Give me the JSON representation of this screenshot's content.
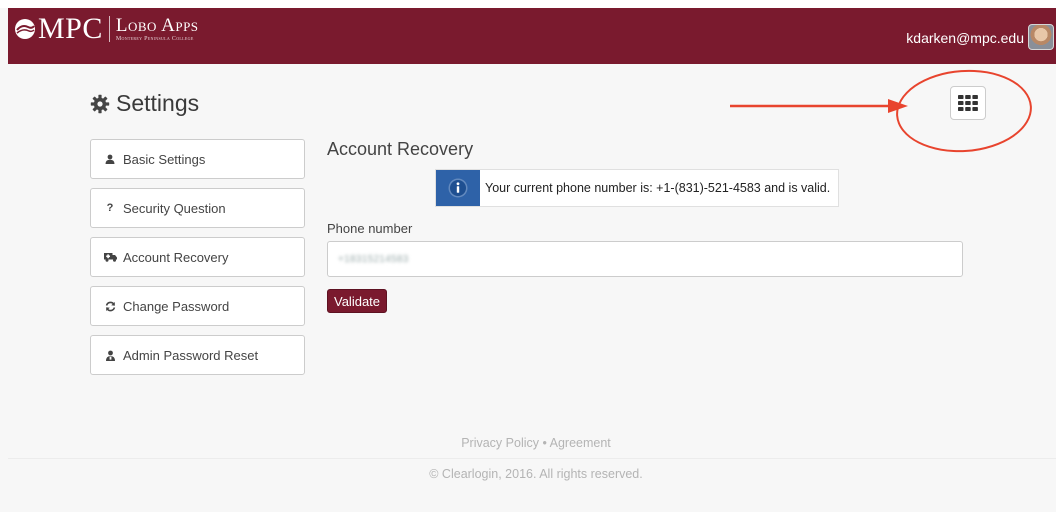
{
  "header": {
    "logo_main": "MPC",
    "logo_apps": "Lobo Apps",
    "logo_sub": "Monterey Peninsula College",
    "user_email": "kdarken@mpc.edu",
    "brand_color": "#7a1a2e"
  },
  "page": {
    "title": "Settings",
    "title_icon": "gear-icon",
    "apps_button_icon": "grid-icon"
  },
  "sidebar": {
    "items": [
      {
        "label": "Basic Settings",
        "icon": "user-icon"
      },
      {
        "label": "Security Question",
        "icon": "question-icon"
      },
      {
        "label": "Account Recovery",
        "icon": "ambulance-icon"
      },
      {
        "label": "Change Password",
        "icon": "refresh-icon"
      },
      {
        "label": "Admin Password Reset",
        "icon": "admin-user-icon"
      }
    ]
  },
  "content": {
    "section_title": "Account Recovery",
    "notice_text": "Your current phone number is: +1-(831)-521-4583 and is valid.",
    "notice_icon": "info-icon",
    "phone_label": "Phone number",
    "phone_value": "+18315214583",
    "validate_label": "Validate"
  },
  "footer": {
    "links": "Privacy Policy • Agreement",
    "copyright": "© Clearlogin, 2016. All rights reserved."
  },
  "annotation": {
    "arrow_color": "#e8442e",
    "circle_color": "#e8442e"
  }
}
